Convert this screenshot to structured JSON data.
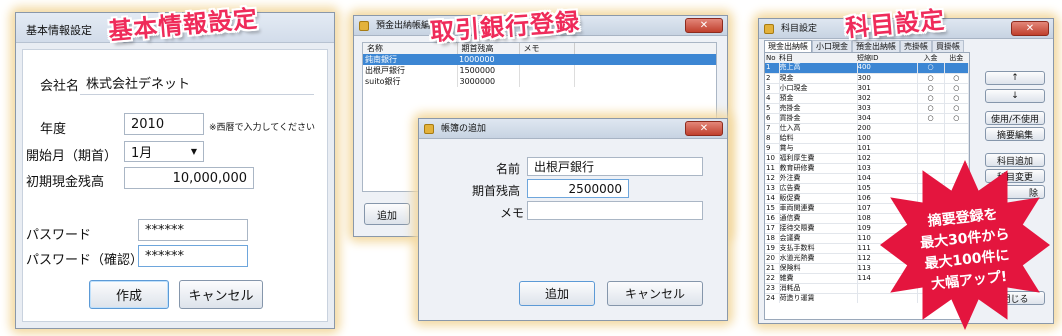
{
  "banners": {
    "basic": "基本情報設定",
    "bank": "取引銀行登録",
    "account": "科目設定"
  },
  "basic_window": {
    "title": "基本情報設定",
    "company_label": "会社名",
    "company_value": "株式会社デネット",
    "year_label": "年度",
    "year_value": "2010",
    "year_hint": "※西暦で入力してください",
    "start_month_label": "開始月（期首）",
    "start_month_value": "1月",
    "opening_cash_label": "初期現金残高",
    "opening_cash_value": "10,000,000",
    "password_label": "パスワード",
    "password_value": "******",
    "password_confirm_label": "パスワード（確認）",
    "password_confirm_value": "******",
    "create_button": "作成",
    "cancel_button": "キャンセル"
  },
  "bank_window": {
    "title": "預金出納帳編集",
    "columns": [
      "名称",
      "期首残高",
      "メモ"
    ],
    "rows": [
      {
        "name": "鈍南銀行",
        "balance": "1000000",
        "memo": ""
      },
      {
        "name": "出根戸銀行",
        "balance": "1500000",
        "memo": ""
      },
      {
        "name": "suito銀行",
        "balance": "3000000",
        "memo": ""
      }
    ],
    "add_button": "追加"
  },
  "ledger_dialog": {
    "title": "帳簿の追加",
    "name_label": "名前",
    "name_value": "出根戸銀行",
    "balance_label": "期首残高",
    "balance_value": "2500000",
    "memo_label": "メモ",
    "memo_value": "",
    "add_button": "追加",
    "cancel_button": "キャンセル"
  },
  "account_window": {
    "title": "科目設定",
    "tabs": [
      "現金出納帳",
      "小口現金",
      "預金出納帳",
      "売掛帳",
      "買掛帳"
    ],
    "columns": [
      "No",
      "科目",
      "短縮ID",
      "入金",
      "出金"
    ],
    "rows": [
      {
        "no": "1",
        "name": "売上高",
        "id": "400",
        "in": "○",
        "out": ""
      },
      {
        "no": "2",
        "name": "現金",
        "id": "300",
        "in": "○",
        "out": "○"
      },
      {
        "no": "3",
        "name": "小口現金",
        "id": "301",
        "in": "○",
        "out": "○"
      },
      {
        "no": "4",
        "name": "預金",
        "id": "302",
        "in": "○",
        "out": "○"
      },
      {
        "no": "5",
        "name": "売掛金",
        "id": "303",
        "in": "○",
        "out": "○"
      },
      {
        "no": "6",
        "name": "買掛金",
        "id": "304",
        "in": "○",
        "out": "○"
      },
      {
        "no": "7",
        "name": "仕入高",
        "id": "200",
        "in": "",
        "out": ""
      },
      {
        "no": "8",
        "name": "給料",
        "id": "100",
        "in": "",
        "out": ""
      },
      {
        "no": "9",
        "name": "賞与",
        "id": "101",
        "in": "",
        "out": ""
      },
      {
        "no": "10",
        "name": "福利厚生費",
        "id": "102",
        "in": "",
        "out": ""
      },
      {
        "no": "11",
        "name": "教育研修費",
        "id": "103",
        "in": "",
        "out": ""
      },
      {
        "no": "12",
        "name": "外注費",
        "id": "104",
        "in": "",
        "out": ""
      },
      {
        "no": "13",
        "name": "広告費",
        "id": "105",
        "in": "",
        "out": ""
      },
      {
        "no": "14",
        "name": "販促費",
        "id": "106",
        "in": "",
        "out": ""
      },
      {
        "no": "15",
        "name": "車両関連費",
        "id": "107",
        "in": "",
        "out": ""
      },
      {
        "no": "16",
        "name": "通信費",
        "id": "108",
        "in": "",
        "out": ""
      },
      {
        "no": "17",
        "name": "接待交際費",
        "id": "109",
        "in": "",
        "out": ""
      },
      {
        "no": "18",
        "name": "会議費",
        "id": "110",
        "in": "",
        "out": ""
      },
      {
        "no": "19",
        "name": "支払手数料",
        "id": "111",
        "in": "",
        "out": ""
      },
      {
        "no": "20",
        "name": "水道光熱費",
        "id": "112",
        "in": "",
        "out": ""
      },
      {
        "no": "21",
        "name": "保険料",
        "id": "113",
        "in": "",
        "out": ""
      },
      {
        "no": "22",
        "name": "雑費",
        "id": "114",
        "in": "",
        "out": ""
      },
      {
        "no": "23",
        "name": "消耗品",
        "id": "",
        "in": "",
        "out": ""
      },
      {
        "no": "24",
        "name": "荷造り運賃",
        "id": "",
        "in": "",
        "out": ""
      }
    ],
    "buttons": {
      "up": "↑",
      "down": "↓",
      "toggle_use": "使用/不使用",
      "edit_memo": "摘要編集",
      "add_account": "科目追加",
      "change_account": "科目変更",
      "delete_partial": "除",
      "close": "閉じる"
    }
  },
  "promo": {
    "line1": "摘要登録を",
    "line2": "最大30件から",
    "line3": "最大100件に",
    "line4": "大幅アップ!"
  },
  "colors": {
    "banner": "#ef2b5a",
    "selection": "#3c86d3",
    "starburst": "#e4153e"
  }
}
